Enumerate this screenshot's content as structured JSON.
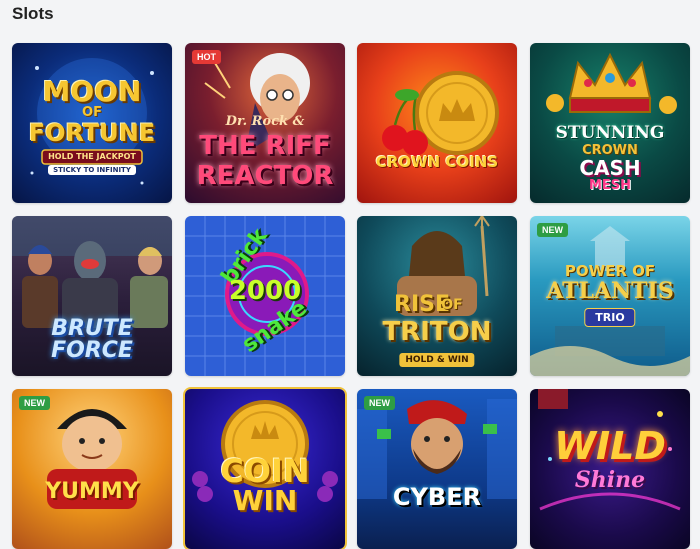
{
  "section": {
    "title": "Slots"
  },
  "games": [
    {
      "title_line1": "MOON",
      "title_line2": "OF",
      "title_line3": "FORTUNE",
      "sub1": "HOLD THE JACKPOT",
      "sub2": "STICKY TO INFINITY",
      "badge": ""
    },
    {
      "pre_title": "Dr. Rock &",
      "title_line1": "THE RIFF",
      "title_line2": "REACTOR",
      "badge": "HOT"
    },
    {
      "title_line1": "CROWN COINS",
      "badge": ""
    },
    {
      "title_line1": "STUNNING",
      "title_line2": "CROWN",
      "title_line3": "CASH",
      "title_line4": "MESH",
      "badge": ""
    },
    {
      "title_line1": "BRUTE",
      "title_line2": "FORCE",
      "badge": ""
    },
    {
      "title_line1": "brick",
      "title_line2": "2000",
      "title_line3": "snake",
      "badge": ""
    },
    {
      "title_line1": "RISE",
      "title_line2": "OF",
      "title_line3": "TRITON",
      "sub1": "HOLD & WIN",
      "badge": ""
    },
    {
      "title_line1": "POWER OF",
      "title_line2": "ATLANTIS",
      "sub1": "TRIO",
      "badge": "NEW"
    },
    {
      "title_line1": "YUMMY",
      "badge": "NEW"
    },
    {
      "title_line1": "COIN",
      "title_line2": "WIN",
      "badge": ""
    },
    {
      "title_line1": "CYBER",
      "badge": "NEW"
    },
    {
      "title_line1": "WILD",
      "title_line2": "Shine",
      "badge": ""
    }
  ]
}
